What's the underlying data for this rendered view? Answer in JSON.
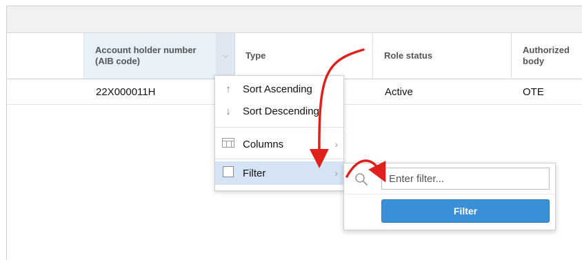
{
  "columns": {
    "aib": "Account holder number (AIB code)",
    "type": "Type",
    "role_status": "Role status",
    "authorized_body": "Authorized body"
  },
  "row": {
    "aib": "22X000011H",
    "role_status": "Active",
    "authorized_body": "OTE"
  },
  "menu": {
    "sort_asc": "Sort Ascending",
    "sort_desc": "Sort Descending",
    "columns": "Columns",
    "filter": "Filter"
  },
  "filter_panel": {
    "placeholder": "Enter filter...",
    "button": "Filter"
  },
  "colors": {
    "accent": "#3a8fd6",
    "annotation_arrow": "#e0201c",
    "menu_highlight": "#d5e4f5"
  }
}
